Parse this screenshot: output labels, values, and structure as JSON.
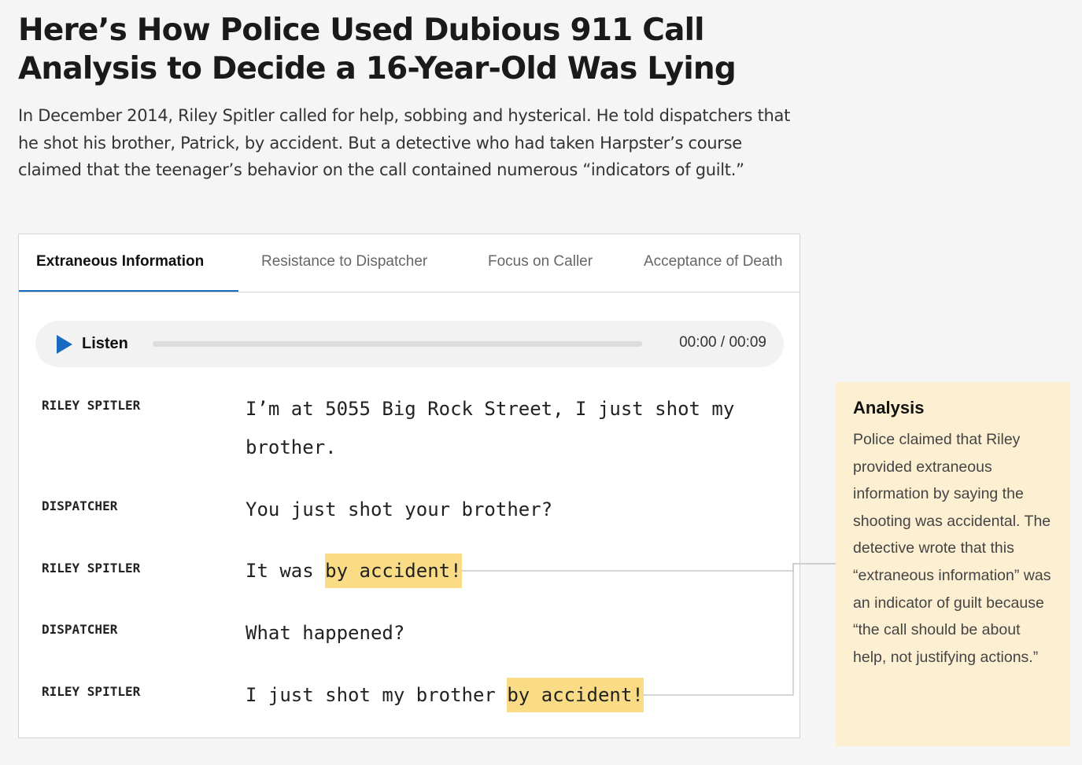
{
  "article": {
    "headline": "Here’s How Police Used Dubious 911 Call Analysis to Decide a 16-Year-Old Was Lying",
    "dek": "In December 2014, Riley Spitler called for help, sobbing and hysterical. He told dispatchers that he shot his brother, Patrick, by accident. But a detective who had taken Harpster’s course claimed that the teenager’s behavior on the call contained numerous “indicators of guilt.”"
  },
  "tabs": [
    {
      "label": "Extraneous Information",
      "active": true
    },
    {
      "label": "Resistance to Dispatcher",
      "active": false
    },
    {
      "label": "Focus on Caller",
      "active": false
    },
    {
      "label": "Acceptance of Death",
      "active": false
    }
  ],
  "player": {
    "label": "Listen",
    "time": "00:00 / 00:09",
    "progress": 0,
    "accent_color": "#1a6bbf"
  },
  "transcript": [
    {
      "speaker": "RILEY SPITLER",
      "text": "I’m at 5055 Big Rock Street, I just shot my brother.",
      "highlight": ""
    },
    {
      "speaker": "DISPATCHER",
      "text": "You just shot your brother?",
      "highlight": ""
    },
    {
      "speaker": "RILEY SPITLER",
      "text": "It was ",
      "highlight": "by accident!"
    },
    {
      "speaker": "DISPATCHER",
      "text": "What happened?",
      "highlight": ""
    },
    {
      "speaker": "RILEY SPITLER",
      "text": "I just shot my brother ",
      "highlight": "by accident!"
    }
  ],
  "analysis": {
    "title": "Analysis",
    "text": "Police claimed that Riley provided extraneous information by saying the shooting was accidental. The detective wrote that this “extraneous information” was an indicator of guilt because “the call should be about help, not justifying actions.”",
    "background_color": "#fdf0d2",
    "highlight_color": "#f9dc85"
  }
}
